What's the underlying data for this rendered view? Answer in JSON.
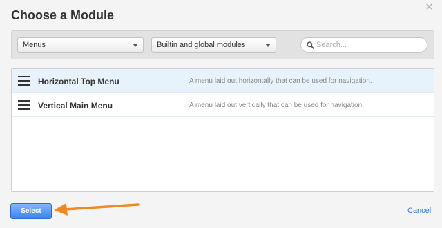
{
  "dialog": {
    "title": "Choose a Module",
    "close_icon": "close-icon",
    "close_glyph": "✕"
  },
  "filters": {
    "category": "Menus",
    "scope": "Builtin and global modules",
    "search_placeholder": "Search...",
    "search_value": ""
  },
  "modules": [
    {
      "name": "Horizontal Top Menu",
      "description": "A menu laid out horizontally that can be used for navigation.",
      "selected": true,
      "icon": "menu-icon"
    },
    {
      "name": "Vertical Main Menu",
      "description": "A menu laid out vertically that can be used for navigation.",
      "selected": false,
      "icon": "menu-icon"
    }
  ],
  "footer": {
    "select_label": "Select",
    "cancel_label": "Cancel"
  },
  "colors": {
    "accent": "#3f84e4",
    "selected_row": "#e8f2fb",
    "annotation_arrow": "#ee8a22",
    "link": "#3576d5"
  }
}
